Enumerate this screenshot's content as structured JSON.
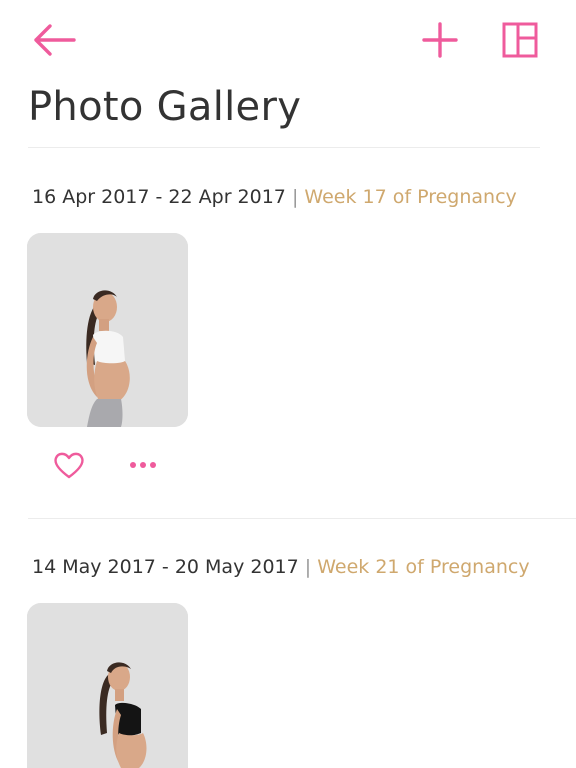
{
  "header": {
    "title": "Photo Gallery",
    "icons": {
      "back": "arrow-left-icon",
      "add": "plus-icon",
      "layout": "grid-layout-icon"
    },
    "accent_color": "#ef5b9c"
  },
  "sections": [
    {
      "date_range": "16 Apr 2017 - 22 Apr 2017",
      "separator": "|",
      "week_label": "Week 17  of Pregnancy",
      "photo_alt": "pregnant woman in white top, side profile",
      "actions": {
        "like_icon": "heart-icon",
        "more_icon": "more-dots-icon"
      }
    },
    {
      "date_range": "14 May 2017 - 20 May 2017",
      "separator": "|",
      "week_label": "Week 21  of Pregnancy",
      "photo_alt": "pregnant woman in black top, side profile"
    }
  ],
  "colors": {
    "week_text": "#cfa86e",
    "photo_bg": "#e0e0e0",
    "divider": "#ececec"
  }
}
